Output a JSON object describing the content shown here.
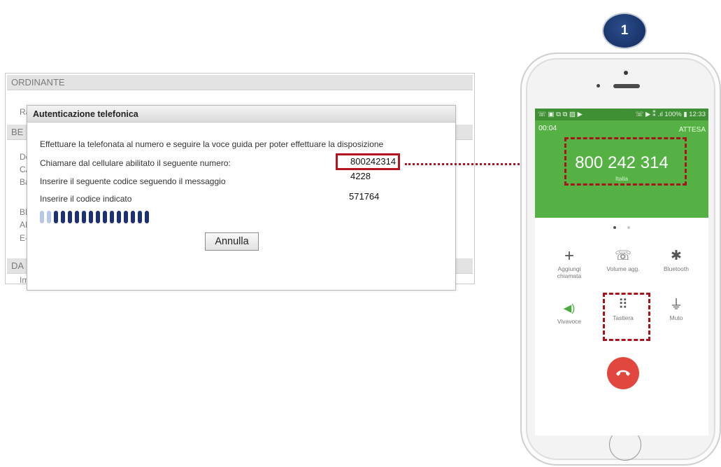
{
  "form": {
    "sections": [
      "ORDINANTE",
      "BE",
      "DA"
    ],
    "row_stubs": [
      "Ra",
      "De",
      "CA",
      "Ba",
      "BI",
      "AI",
      "E-",
      "Im"
    ]
  },
  "dialog": {
    "title": "Autenticazione telefonica",
    "instruction": "Effettuare la telefonata al numero e seguire la voce guida per poter effettuare la disposizione",
    "rows": [
      {
        "label": "Chiamare dal cellulare abilitato il seguente numero:",
        "value": "800242314"
      },
      {
        "label": "Inserire il seguente codice seguendo il messaggio",
        "value": "4228"
      },
      {
        "label": "Inserire il codice indicato",
        "value": "571764"
      }
    ],
    "progress": {
      "filled_segments": 14,
      "light_segments": 2
    },
    "cancel_label": "Annulla"
  },
  "step_badge": "1",
  "phone": {
    "status_left_icons": "☏ ▣ ⧉ ⧉ ▨ ▶",
    "status_right": "☏ ▶ ⁑ .ıl 100% ▮ 12:33",
    "call_timer": "00:04",
    "call_state": "ATTESA",
    "number": "800 242 314",
    "country": "Italia",
    "controls": [
      {
        "icon": "plus-icon",
        "glyph": "+",
        "label": "Aggiungi\nchiamata"
      },
      {
        "icon": "volume-phone-icon",
        "glyph": "☏",
        "label": "Volume agg."
      },
      {
        "icon": "bluetooth-icon",
        "glyph": "✱",
        "label": "Bluetooth"
      },
      {
        "icon": "speaker-icon",
        "glyph": "◀)",
        "label": "Vivavoce"
      },
      {
        "icon": "keypad-icon",
        "glyph": "⠿",
        "label": "Tastiera"
      },
      {
        "icon": "mute-icon",
        "glyph": "⏚",
        "label": "Muto"
      }
    ]
  },
  "colors": {
    "call_green": "#55b144",
    "status_green": "#3f8f35",
    "highlight_red": "#b3121f",
    "end_call_red": "#e2473f",
    "progress_blue": "#1b2f7a"
  }
}
